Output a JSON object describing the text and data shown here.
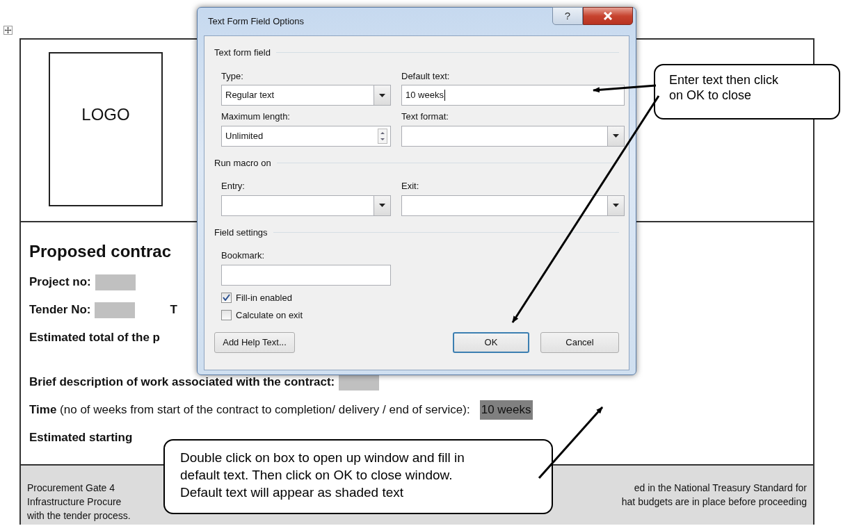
{
  "document": {
    "logo_text": "LOGO",
    "heading": "Proposed contrac",
    "lines": [
      {
        "kind": "field",
        "label": "Project no:"
      },
      {
        "kind": "field",
        "label": "Tender No:",
        "trailing": "T"
      },
      {
        "kind": "plain",
        "label": "Estimated total of the p"
      },
      {
        "kind": "field",
        "label": "Brief description of work associated with the contract:"
      },
      {
        "kind": "value",
        "label": "**Time** (no of weeks from start of the contract to completion/ delivery / end of service):",
        "value": "10 weeks"
      },
      {
        "kind": "plain",
        "label": "Estimated starting"
      }
    ],
    "footer": [
      {
        "left": "Procurement Gate 4",
        "right": "ed in the National Treasury Standard for"
      },
      {
        "left": "Infrastructure Procure",
        "right": "hat budgets are in place before proceeding"
      },
      {
        "left": "with the tender process."
      }
    ]
  },
  "dialog": {
    "title": "Text Form Field Options",
    "help_button": "?",
    "text_form_field": {
      "heading": "Text form field",
      "type": {
        "label": "Type:",
        "value": "Regular text"
      },
      "default_text": {
        "label": "Default text:",
        "value": "10 weeks"
      },
      "maximum_length": {
        "label": "Maximum length:",
        "value": "Unlimited"
      },
      "text_format": {
        "label": "Text format:"
      }
    },
    "run_macro_on": {
      "heading": "Run macro on",
      "entry": {
        "label": "Entry:"
      },
      "exit": {
        "label": "Exit:"
      }
    },
    "field_settings": {
      "heading": "Field settings",
      "bookmark": {
        "label": "Bookmark:"
      },
      "checkboxes": [
        {
          "label": "Fill-in enabled",
          "checked": true
        },
        {
          "label": "Calculate on exit",
          "checked": false
        }
      ]
    },
    "buttons": [
      {
        "label": "Add Help Text...",
        "kind": "normal"
      },
      {
        "label": "OK",
        "kind": "default"
      },
      {
        "label": "Cancel",
        "kind": "normal"
      }
    ]
  },
  "callouts": [
    {
      "text": "Enter text then click on OK to close"
    },
    {
      "text": "Double click on box to open up window and fill in default text. Then click on OK to close window. Default text will appear as shaded text"
    }
  ]
}
